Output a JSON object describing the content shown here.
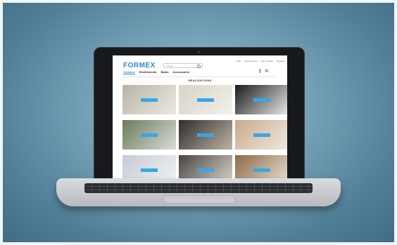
{
  "site": {
    "logo": "FORMEX",
    "search_placeholder": "Trouvez...",
    "top_links": [
      "Aide",
      "Inscrivez-vous",
      "Mon compte",
      "Français"
    ],
    "nav": [
      {
        "label": "Cuisines",
        "active": true
      },
      {
        "label": "Revêtements",
        "active": false
      },
      {
        "label": "Bains",
        "active": false
      },
      {
        "label": "Accessoires",
        "active": false
      }
    ],
    "section_title": "RÉALISATIONS",
    "accent_color": "#2f86c8",
    "tag_color": "#39a6e3"
  },
  "icons": {
    "search": "search-icon",
    "account": "user-icon",
    "cart": "cart-icon"
  },
  "gallery": [
    {
      "name": "kitchen-photo-1",
      "palette": [
        "#b9b3a6",
        "#ece9e2"
      ]
    },
    {
      "name": "kitchen-photo-2",
      "palette": [
        "#d8d2c6",
        "#f3f1ec"
      ]
    },
    {
      "name": "kitchen-photo-3",
      "palette": [
        "#1b1b1c",
        "#e9e9e9"
      ]
    },
    {
      "name": "kitchen-photo-4",
      "palette": [
        "#6b7a5c",
        "#d9dbd6"
      ]
    },
    {
      "name": "kitchen-photo-5",
      "palette": [
        "#2f2d2b",
        "#bdb3a5"
      ]
    },
    {
      "name": "kitchen-photo-6",
      "palette": [
        "#c8a98a",
        "#efe9e2"
      ]
    },
    {
      "name": "kitchen-photo-7",
      "palette": [
        "#c6ccd3",
        "#f1f3f5"
      ]
    },
    {
      "name": "kitchen-photo-8",
      "palette": [
        "#4a4540",
        "#d9d4cd"
      ]
    },
    {
      "name": "kitchen-photo-9",
      "palette": [
        "#8e6a45",
        "#e8e1d8"
      ]
    }
  ]
}
